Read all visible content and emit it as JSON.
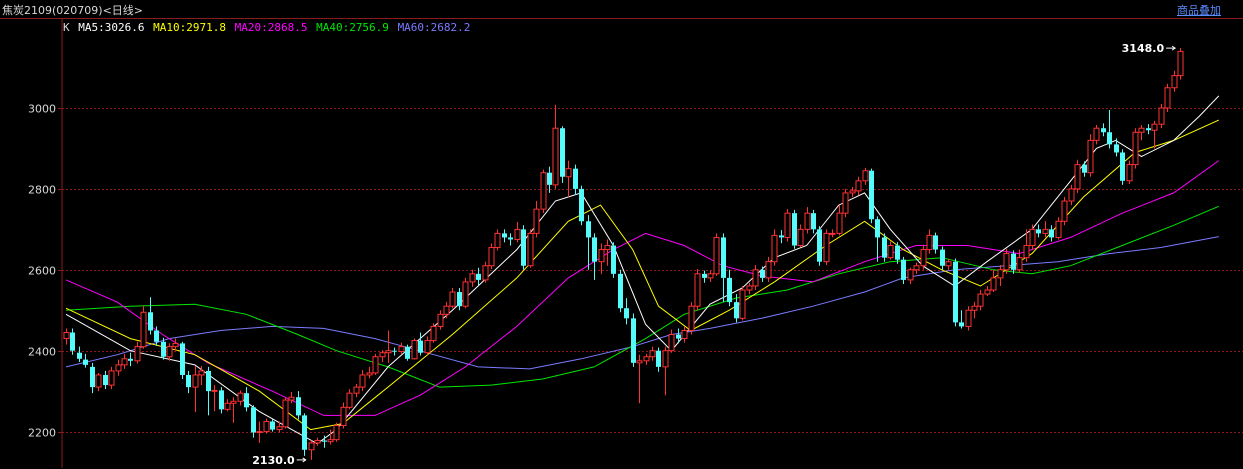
{
  "header": {
    "title": "焦炭2109(020709)<日线>",
    "overlay_link": "商品叠加"
  },
  "legend": {
    "k_label": "K",
    "ma5": "MA5:3026.6",
    "ma10": "MA10:2971.8",
    "ma20": "MA20:2868.5",
    "ma40": "MA40:2756.9",
    "ma60": "MA60:2682.2"
  },
  "colors": {
    "background": "#000000",
    "up": "#ff3232",
    "down": "#54fcfc",
    "grid": "#8b1c1c",
    "ma5": "#ffffff",
    "ma10": "#ffff00",
    "ma20": "#ff00ff",
    "ma40": "#00e600",
    "ma60": "#7b7bff"
  },
  "chart_data": {
    "type": "candlestick",
    "y_ticks": [
      2200,
      2400,
      2600,
      2800,
      3000
    ],
    "ylim": [
      2110,
      3220
    ],
    "annotations": {
      "high_label": "3148.0",
      "high_value": 3148.0,
      "low_label": "2130.0",
      "low_value": 2130.0
    },
    "candles": [
      [
        2430,
        2445,
        2415,
        2455
      ],
      [
        2445,
        2400,
        2390,
        2455
      ],
      [
        2395,
        2380,
        2372,
        2410
      ],
      [
        2378,
        2365,
        2358,
        2392
      ],
      [
        2360,
        2310,
        2295,
        2370
      ],
      [
        2310,
        2340,
        2300,
        2345
      ],
      [
        2340,
        2315,
        2305,
        2350
      ],
      [
        2315,
        2350,
        2305,
        2360
      ],
      [
        2350,
        2365,
        2338,
        2378
      ],
      [
        2365,
        2380,
        2355,
        2392
      ],
      [
        2380,
        2375,
        2362,
        2395
      ],
      [
        2375,
        2410,
        2368,
        2422
      ],
      [
        2410,
        2495,
        2405,
        2510
      ],
      [
        2495,
        2450,
        2440,
        2532
      ],
      [
        2450,
        2422,
        2412,
        2460
      ],
      [
        2422,
        2385,
        2378,
        2432
      ],
      [
        2385,
        2410,
        2375,
        2418
      ],
      [
        2410,
        2418,
        2400,
        2430
      ],
      [
        2418,
        2340,
        2330,
        2422
      ],
      [
        2340,
        2310,
        2295,
        2350
      ],
      [
        2310,
        2340,
        2248,
        2362
      ],
      [
        2340,
        2350,
        2315,
        2362
      ],
      [
        2350,
        2300,
        2240,
        2360
      ],
      [
        2300,
        2302,
        2250,
        2315
      ],
      [
        2302,
        2255,
        2245,
        2310
      ],
      [
        2255,
        2270,
        2250,
        2280
      ],
      [
        2270,
        2275,
        2222,
        2285
      ],
      [
        2275,
        2295,
        2265,
        2302
      ],
      [
        2295,
        2260,
        2250,
        2310
      ],
      [
        2260,
        2198,
        2185,
        2265
      ],
      [
        2198,
        2200,
        2172,
        2225
      ],
      [
        2200,
        2225,
        2195,
        2232
      ],
      [
        2225,
        2205,
        2200,
        2230
      ],
      [
        2205,
        2212,
        2198,
        2225
      ],
      [
        2212,
        2278,
        2208,
        2285
      ],
      [
        2278,
        2285,
        2270,
        2298
      ],
      [
        2285,
        2240,
        2230,
        2300
      ],
      [
        2240,
        2155,
        2140,
        2245
      ],
      [
        2155,
        2172,
        2130,
        2178
      ],
      [
        2172,
        2178,
        2165,
        2185
      ],
      [
        2178,
        2175,
        2160,
        2190
      ],
      [
        2175,
        2180,
        2168,
        2205
      ],
      [
        2180,
        2215,
        2175,
        2222
      ],
      [
        2215,
        2260,
        2208,
        2272
      ],
      [
        2260,
        2295,
        2255,
        2305
      ],
      [
        2295,
        2310,
        2285,
        2318
      ],
      [
        2310,
        2340,
        2300,
        2352
      ],
      [
        2340,
        2345,
        2332,
        2360
      ],
      [
        2345,
        2385,
        2340,
        2392
      ],
      [
        2385,
        2395,
        2372,
        2402
      ],
      [
        2395,
        2400,
        2370,
        2450
      ],
      [
        2400,
        2398,
        2388,
        2408
      ],
      [
        2398,
        2410,
        2392,
        2420
      ],
      [
        2410,
        2380,
        2375,
        2415
      ],
      [
        2380,
        2425,
        2378,
        2430
      ],
      [
        2425,
        2395,
        2388,
        2445
      ],
      [
        2395,
        2425,
        2390,
        2435
      ],
      [
        2425,
        2460,
        2420,
        2468
      ],
      [
        2460,
        2490,
        2452,
        2500
      ],
      [
        2490,
        2510,
        2480,
        2520
      ],
      [
        2510,
        2545,
        2505,
        2555
      ],
      [
        2545,
        2510,
        2500,
        2555
      ],
      [
        2510,
        2570,
        2505,
        2580
      ],
      [
        2570,
        2590,
        2558,
        2600
      ],
      [
        2590,
        2575,
        2562,
        2605
      ],
      [
        2575,
        2610,
        2568,
        2620
      ],
      [
        2610,
        2655,
        2602,
        2665
      ],
      [
        2655,
        2690,
        2648,
        2700
      ],
      [
        2690,
        2680,
        2668,
        2700
      ],
      [
        2680,
        2675,
        2660,
        2690
      ],
      [
        2675,
        2700,
        2668,
        2718
      ],
      [
        2700,
        2610,
        2600,
        2710
      ],
      [
        2610,
        2690,
        2605,
        2700
      ],
      [
        2690,
        2750,
        2680,
        2770
      ],
      [
        2750,
        2840,
        2740,
        2848
      ],
      [
        2840,
        2810,
        2790,
        2855
      ],
      [
        2810,
        2950,
        2800,
        3008
      ],
      [
        2950,
        2830,
        2815,
        2955
      ],
      [
        2830,
        2850,
        2780,
        2870
      ],
      [
        2850,
        2800,
        2785,
        2860
      ],
      [
        2800,
        2720,
        2710,
        2808
      ],
      [
        2720,
        2680,
        2600,
        2735
      ],
      [
        2680,
        2620,
        2575,
        2690
      ],
      [
        2620,
        2650,
        2590,
        2665
      ],
      [
        2650,
        2660,
        2610,
        2675
      ],
      [
        2660,
        2590,
        2580,
        2668
      ],
      [
        2590,
        2505,
        2495,
        2600
      ],
      [
        2505,
        2480,
        2465,
        2530
      ],
      [
        2480,
        2370,
        2360,
        2492
      ],
      [
        2370,
        2375,
        2270,
        2390
      ],
      [
        2375,
        2385,
        2365,
        2392
      ],
      [
        2385,
        2400,
        2375,
        2410
      ],
      [
        2400,
        2360,
        2348,
        2408
      ],
      [
        2360,
        2400,
        2290,
        2410
      ],
      [
        2400,
        2440,
        2395,
        2452
      ],
      [
        2440,
        2430,
        2418,
        2455
      ],
      [
        2430,
        2450,
        2420,
        2460
      ],
      [
        2450,
        2510,
        2440,
        2520
      ],
      [
        2510,
        2590,
        2500,
        2602
      ],
      [
        2590,
        2580,
        2568,
        2598
      ],
      [
        2580,
        2590,
        2570,
        2598
      ],
      [
        2590,
        2680,
        2585,
        2690
      ],
      [
        2680,
        2580,
        2520,
        2690
      ],
      [
        2580,
        2520,
        2510,
        2600
      ],
      [
        2520,
        2480,
        2470,
        2540
      ],
      [
        2480,
        2550,
        2475,
        2560
      ],
      [
        2550,
        2560,
        2540,
        2568
      ],
      [
        2560,
        2600,
        2550,
        2612
      ],
      [
        2600,
        2580,
        2570,
        2608
      ],
      [
        2580,
        2620,
        2570,
        2632
      ],
      [
        2620,
        2685,
        2610,
        2700
      ],
      [
        2685,
        2680,
        2666,
        2698
      ],
      [
        2680,
        2740,
        2670,
        2750
      ],
      [
        2740,
        2660,
        2652,
        2748
      ],
      [
        2660,
        2700,
        2655,
        2712
      ],
      [
        2700,
        2740,
        2690,
        2755
      ],
      [
        2740,
        2700,
        2690,
        2748
      ],
      [
        2700,
        2620,
        2610,
        2708
      ],
      [
        2620,
        2690,
        2612,
        2700
      ],
      [
        2690,
        2690,
        2680,
        2700
      ],
      [
        2690,
        2740,
        2685,
        2760
      ],
      [
        2740,
        2790,
        2730,
        2800
      ],
      [
        2790,
        2795,
        2780,
        2805
      ],
      [
        2795,
        2820,
        2785,
        2830
      ],
      [
        2820,
        2845,
        2810,
        2852
      ],
      [
        2845,
        2725,
        2715,
        2850
      ],
      [
        2725,
        2680,
        2620,
        2732
      ],
      [
        2680,
        2630,
        2620,
        2690
      ],
      [
        2630,
        2660,
        2625,
        2670
      ],
      [
        2660,
        2625,
        2615,
        2668
      ],
      [
        2625,
        2575,
        2565,
        2632
      ],
      [
        2575,
        2600,
        2565,
        2605
      ],
      [
        2600,
        2610,
        2590,
        2618
      ],
      [
        2610,
        2650,
        2600,
        2662
      ],
      [
        2650,
        2685,
        2640,
        2700
      ],
      [
        2685,
        2650,
        2640,
        2692
      ],
      [
        2650,
        2610,
        2600,
        2658
      ],
      [
        2610,
        2620,
        2600,
        2628
      ],
      [
        2620,
        2470,
        2460,
        2628
      ],
      [
        2470,
        2460,
        2455,
        2500
      ],
      [
        2460,
        2500,
        2450,
        2510
      ],
      [
        2500,
        2510,
        2480,
        2520
      ],
      [
        2510,
        2540,
        2500,
        2550
      ],
      [
        2540,
        2550,
        2535,
        2560
      ],
      [
        2550,
        2580,
        2545,
        2600
      ],
      [
        2580,
        2600,
        2560,
        2612
      ],
      [
        2600,
        2640,
        2590,
        2652
      ],
      [
        2640,
        2600,
        2590,
        2648
      ],
      [
        2600,
        2630,
        2592,
        2650
      ],
      [
        2630,
        2660,
        2620,
        2700
      ],
      [
        2660,
        2700,
        2650,
        2712
      ],
      [
        2700,
        2690,
        2680,
        2712
      ],
      [
        2690,
        2700,
        2680,
        2720
      ],
      [
        2700,
        2680,
        2670,
        2710
      ],
      [
        2680,
        2720,
        2675,
        2730
      ],
      [
        2720,
        2770,
        2710,
        2780
      ],
      [
        2770,
        2800,
        2760,
        2810
      ],
      [
        2800,
        2860,
        2790,
        2872
      ],
      [
        2860,
        2840,
        2830,
        2868
      ],
      [
        2840,
        2920,
        2830,
        2935
      ],
      [
        2920,
        2950,
        2910,
        2958
      ],
      [
        2950,
        2940,
        2930,
        2962
      ],
      [
        2940,
        2910,
        2900,
        2995
      ],
      [
        2910,
        2890,
        2880,
        2925
      ],
      [
        2890,
        2820,
        2810,
        2898
      ],
      [
        2820,
        2860,
        2812,
        2870
      ],
      [
        2860,
        2940,
        2850,
        2950
      ],
      [
        2940,
        2950,
        2920,
        2958
      ],
      [
        2950,
        2945,
        2935,
        2960
      ],
      [
        2945,
        2960,
        2900,
        2968
      ],
      [
        2960,
        3000,
        2950,
        3010
      ],
      [
        3000,
        3050,
        2990,
        3060
      ],
      [
        3050,
        3080,
        3040,
        3092
      ],
      [
        3080,
        3140,
        3070,
        3148
      ]
    ],
    "ma5": [
      [
        0,
        2490
      ],
      [
        10,
        2400
      ],
      [
        20,
        2365
      ],
      [
        30,
        2250
      ],
      [
        39,
        2170
      ],
      [
        42,
        2205
      ],
      [
        50,
        2360
      ],
      [
        60,
        2500
      ],
      [
        70,
        2650
      ],
      [
        76,
        2770
      ],
      [
        80,
        2790
      ],
      [
        85,
        2660
      ],
      [
        90,
        2465
      ],
      [
        94,
        2400
      ],
      [
        100,
        2515
      ],
      [
        105,
        2555
      ],
      [
        110,
        2630
      ],
      [
        115,
        2660
      ],
      [
        120,
        2760
      ],
      [
        124,
        2790
      ],
      [
        128,
        2700
      ],
      [
        133,
        2610
      ],
      [
        138,
        2560
      ],
      [
        143,
        2620
      ],
      [
        150,
        2700
      ],
      [
        155,
        2800
      ],
      [
        160,
        2900
      ],
      [
        163,
        2920
      ],
      [
        167,
        2880
      ],
      [
        172,
        2920
      ],
      [
        176,
        2980
      ],
      [
        179,
        3030
      ]
    ],
    "ma10": [
      [
        0,
        2505
      ],
      [
        10,
        2430
      ],
      [
        20,
        2390
      ],
      [
        30,
        2300
      ],
      [
        38,
        2205
      ],
      [
        43,
        2220
      ],
      [
        50,
        2310
      ],
      [
        60,
        2440
      ],
      [
        70,
        2580
      ],
      [
        78,
        2720
      ],
      [
        83,
        2760
      ],
      [
        88,
        2650
      ],
      [
        92,
        2510
      ],
      [
        97,
        2450
      ],
      [
        103,
        2500
      ],
      [
        110,
        2570
      ],
      [
        118,
        2660
      ],
      [
        124,
        2720
      ],
      [
        130,
        2650
      ],
      [
        136,
        2600
      ],
      [
        142,
        2560
      ],
      [
        150,
        2640
      ],
      [
        158,
        2780
      ],
      [
        166,
        2890
      ],
      [
        172,
        2920
      ],
      [
        179,
        2970
      ]
    ],
    "ma20": [
      [
        0,
        2575
      ],
      [
        8,
        2520
      ],
      [
        15,
        2440
      ],
      [
        22,
        2370
      ],
      [
        32,
        2300
      ],
      [
        40,
        2240
      ],
      [
        48,
        2240
      ],
      [
        55,
        2290
      ],
      [
        62,
        2360
      ],
      [
        70,
        2460
      ],
      [
        78,
        2580
      ],
      [
        85,
        2650
      ],
      [
        90,
        2690
      ],
      [
        96,
        2660
      ],
      [
        102,
        2610
      ],
      [
        108,
        2585
      ],
      [
        116,
        2570
      ],
      [
        124,
        2620
      ],
      [
        132,
        2660
      ],
      [
        140,
        2660
      ],
      [
        148,
        2640
      ],
      [
        156,
        2680
      ],
      [
        164,
        2740
      ],
      [
        172,
        2790
      ],
      [
        179,
        2870
      ]
    ],
    "ma40": [
      [
        0,
        2500
      ],
      [
        10,
        2510
      ],
      [
        20,
        2515
      ],
      [
        28,
        2490
      ],
      [
        36,
        2440
      ],
      [
        42,
        2400
      ],
      [
        50,
        2360
      ],
      [
        58,
        2310
      ],
      [
        66,
        2315
      ],
      [
        74,
        2330
      ],
      [
        82,
        2360
      ],
      [
        90,
        2430
      ],
      [
        96,
        2490
      ],
      [
        104,
        2530
      ],
      [
        112,
        2550
      ],
      [
        120,
        2590
      ],
      [
        128,
        2620
      ],
      [
        136,
        2630
      ],
      [
        144,
        2600
      ],
      [
        150,
        2590
      ],
      [
        156,
        2610
      ],
      [
        164,
        2660
      ],
      [
        172,
        2710
      ],
      [
        179,
        2757
      ]
    ],
    "ma60": [
      [
        0,
        2360
      ],
      [
        8,
        2390
      ],
      [
        16,
        2430
      ],
      [
        24,
        2450
      ],
      [
        32,
        2460
      ],
      [
        40,
        2455
      ],
      [
        48,
        2430
      ],
      [
        56,
        2395
      ],
      [
        64,
        2360
      ],
      [
        72,
        2355
      ],
      [
        80,
        2380
      ],
      [
        88,
        2410
      ],
      [
        94,
        2440
      ],
      [
        100,
        2455
      ],
      [
        108,
        2480
      ],
      [
        116,
        2510
      ],
      [
        124,
        2545
      ],
      [
        130,
        2580
      ],
      [
        138,
        2600
      ],
      [
        146,
        2610
      ],
      [
        154,
        2620
      ],
      [
        162,
        2640
      ],
      [
        170,
        2655
      ],
      [
        179,
        2682
      ]
    ]
  }
}
